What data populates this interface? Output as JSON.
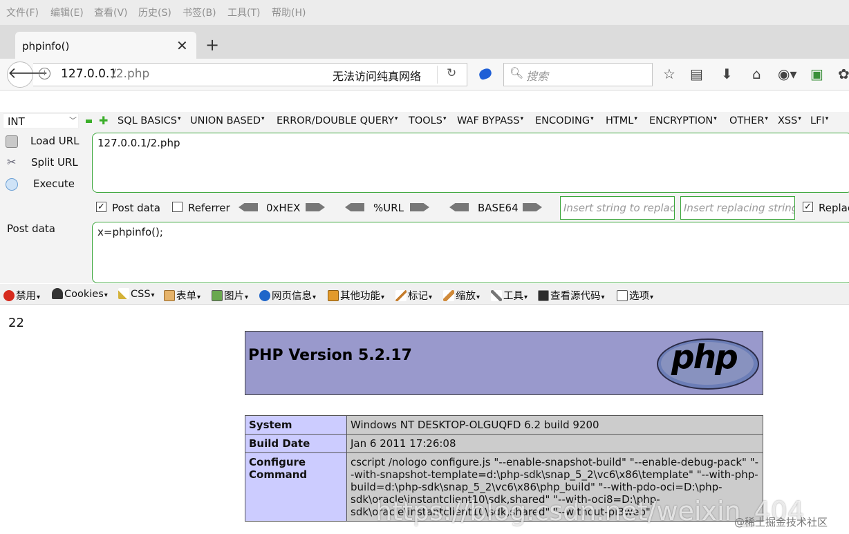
{
  "menubar": [
    "文件(F)",
    "编辑(E)",
    "查看(V)",
    "历史(S)",
    "书签(B)",
    "工具(T)",
    "帮助(H)"
  ],
  "tab": {
    "title": "phpinfo()",
    "close": "✕",
    "new": "+"
  },
  "nav": {
    "host": "127.0.0.1",
    "path": "/2.php",
    "status": "无法访问纯真网络",
    "search_placeholder": "搜索"
  },
  "hackbar": {
    "select_value": "INT",
    "menus": [
      "SQL BASICS",
      "UNION BASED",
      "ERROR/DOUBLE QUERY",
      "TOOLS",
      "WAF BYPASS",
      "ENCODING",
      "HTML",
      "ENCRYPTION",
      "OTHER",
      "XSS",
      "LFI"
    ],
    "load_url": "Load URL",
    "split_url": "Split URL",
    "execute": "Execute",
    "url_value": "127.0.0.1/2.php",
    "post_data_checkbox": "Post data",
    "referrer_checkbox": "Referrer",
    "enc_hex": "0xHEX",
    "enc_url": "%URL",
    "enc_b64": "BASE64",
    "replace_placeholder": "Insert string to replace",
    "replacing_placeholder": "Insert replacing string",
    "replace_all": "Replace All",
    "post_label": "Post data",
    "post_value": "x=phpinfo();"
  },
  "devtoolbar": [
    "禁用",
    "Cookies",
    "CSS",
    "表单",
    "图片",
    "网页信息",
    "其他功能",
    "标记",
    "缩放",
    "工具",
    "查看源代码",
    "选项"
  ],
  "page": {
    "output_number": "22",
    "php_version": "PHP Version 5.2.17",
    "php_logo": "php",
    "rows": [
      {
        "key": "System",
        "value": "Windows NT DESKTOP-OLGUQFD 6.2 build 9200"
      },
      {
        "key": "Build Date",
        "value": "Jan 6 2011 17:26:08"
      },
      {
        "key": "Configure Command",
        "value": "cscript /nologo configure.js \"--enable-snapshot-build\" \"--enable-debug-pack\" \"--with-snapshot-template=d:\\php-sdk\\snap_5_2\\vc6\\x86\\template\" \"--with-php-build=d:\\php-sdk\\snap_5_2\\vc6\\x86\\php_build\" \"--with-pdo-oci=D:\\php-sdk\\oracle\\instantclient10\\sdk,shared\" \"--with-oci8=D:\\php-sdk\\oracle\\instantclient10\\sdk,shared\" \"--without-pi3web\""
      }
    ]
  },
  "watermark": "https://blog.csdn.net/weixin_404",
  "watermark2": "@稀土掘金技术社区",
  "colors": {
    "php_header": "#9999cc",
    "key_cell": "#ccccff",
    "value_cell": "#cccccc",
    "hackbar_green": "#3aa63a"
  }
}
